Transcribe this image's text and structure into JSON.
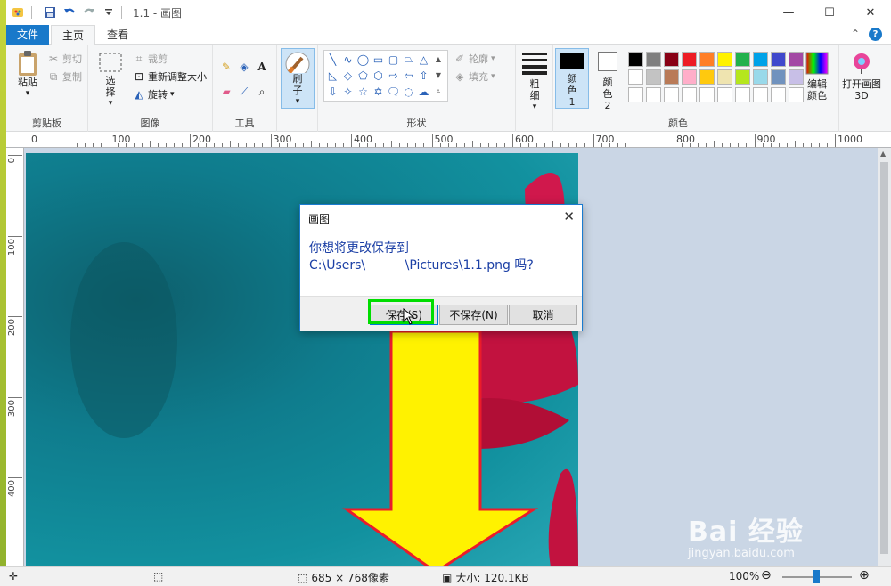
{
  "window": {
    "title": "1.1 - 画图",
    "controls": {
      "minimize": "—",
      "maximize": "☐",
      "close": "✕"
    }
  },
  "tabs": [
    {
      "label": "文件",
      "active": false
    },
    {
      "label": "主页",
      "active": true
    },
    {
      "label": "查看",
      "active": false
    }
  ],
  "ribbon": {
    "clipboard": {
      "label": "剪贴板",
      "paste": "粘贴",
      "cut": "剪切",
      "copy": "复制"
    },
    "image": {
      "label": "图像",
      "select": "选择",
      "crop": "裁剪",
      "resize": "重新调整大小",
      "rotate": "旋转"
    },
    "tools": {
      "label": "工具"
    },
    "brushes": {
      "label": "刷子"
    },
    "shapes": {
      "label": "形状",
      "outline": "轮廓",
      "fill": "填充"
    },
    "size": {
      "label": "粗细"
    },
    "colors": {
      "label": "颜色",
      "color1": "颜色 1",
      "color2": "颜色 2",
      "edit": "编辑颜色",
      "paint3d": "打开画图 3D",
      "color1_value": "#000000",
      "color2_value": "#ffffff",
      "palette_row1": [
        "#000000",
        "#7f7f7f",
        "#880015",
        "#ed1c24",
        "#ff7f27",
        "#fff200",
        "#22b14c",
        "#00a2e8",
        "#3f48cc",
        "#a349a4"
      ],
      "palette_row2": [
        "#ffffff",
        "#c3c3c3",
        "#b97a57",
        "#ffaec9",
        "#ffc90e",
        "#efe4b0",
        "#b5e61d",
        "#99d9ea",
        "#7092be",
        "#c8bfe7"
      ],
      "palette_row3": [
        "#ffffff",
        "#ffffff",
        "#ffffff",
        "#ffffff",
        "#ffffff",
        "#ffffff",
        "#ffffff",
        "#ffffff",
        "#ffffff",
        "#ffffff"
      ]
    }
  },
  "ruler": {
    "top_labels": [
      "0",
      "100",
      "200",
      "300",
      "400",
      "500",
      "600",
      "700",
      "800",
      "900",
      "1000"
    ],
    "left_labels": [
      "0",
      "100",
      "200",
      "300",
      "400"
    ]
  },
  "dialog": {
    "title": "画图",
    "message_line1": "你想将更改保存到",
    "message_line2": "C:\\Users\\          \\Pictures\\1.1.png 吗?",
    "save": "保存(S)",
    "dont_save": "不保存(N)",
    "cancel": "取消"
  },
  "status": {
    "dimensions": "685 × 768像素",
    "size": "大小: 120.1KB",
    "zoom": "100%"
  },
  "watermark": {
    "main": "Bai  经验",
    "sub": "jingyan.baidu.com"
  }
}
